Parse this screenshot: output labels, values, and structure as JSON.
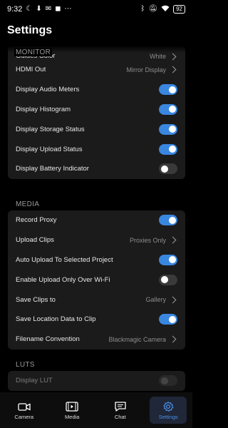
{
  "status_bar": {
    "time": "9:32",
    "battery": "92",
    "icons_left": [
      "moon-icon",
      "download-icon",
      "mail-icon",
      "notification-icon",
      "more-icon"
    ],
    "icons_right": [
      "bluetooth-icon",
      "mute-icon",
      "wifi-icon",
      "battery-icon"
    ]
  },
  "page": {
    "title": "Settings"
  },
  "sections": {
    "monitor": {
      "label": "MONITOR",
      "rows": {
        "guides_color": {
          "label": "Guides Color",
          "value": "White"
        },
        "hdmi_out": {
          "label": "HDMI Out",
          "value": "Mirror Display"
        },
        "audio_meters": {
          "label": "Display Audio Meters",
          "on": true
        },
        "histogram": {
          "label": "Display Histogram",
          "on": true
        },
        "storage_status": {
          "label": "Display Storage Status",
          "on": true
        },
        "upload_status": {
          "label": "Display Upload Status",
          "on": true
        },
        "battery_indicator": {
          "label": "Display Battery Indicator",
          "on": false
        }
      }
    },
    "media": {
      "label": "MEDIA",
      "rows": {
        "record_proxy": {
          "label": "Record Proxy",
          "on": true
        },
        "upload_clips": {
          "label": "Upload Clips",
          "value": "Proxies Only"
        },
        "auto_upload": {
          "label": "Auto Upload To Selected Project",
          "on": true
        },
        "wifi_only": {
          "label": "Enable Upload Only Over Wi-Fi",
          "on": false
        },
        "save_clips": {
          "label": "Save Clips to",
          "value": "Gallery"
        },
        "save_location": {
          "label": "Save Location Data to Clip",
          "on": true
        },
        "filename": {
          "label": "Filename Convention",
          "value": "Blackmagic Camera"
        }
      }
    },
    "luts": {
      "label": "LUTS",
      "rows": {
        "display_lut": {
          "label": "Display LUT",
          "on": false
        }
      }
    }
  },
  "nav": {
    "camera": "Camera",
    "media": "Media",
    "chat": "Chat",
    "settings": "Settings"
  },
  "colors": {
    "accent": "#3a87e0",
    "card": "#1b1b1b",
    "background": "#000000"
  }
}
